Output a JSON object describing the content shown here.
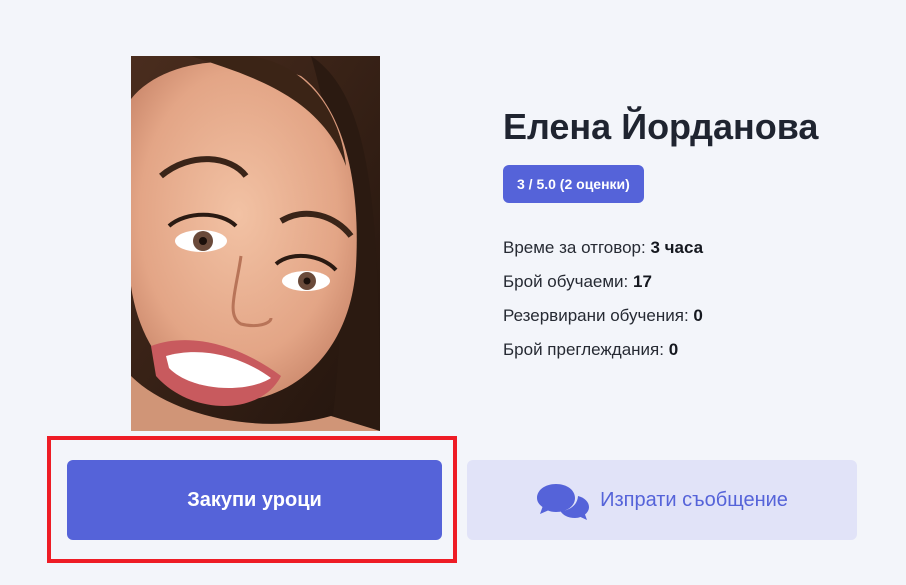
{
  "tutor": {
    "name": "Елена Йорданова",
    "rating": "3 / 5.0 (2 оценки)",
    "photo_alt": "tutor-photo"
  },
  "stats": [
    {
      "label": "Време за отговор: ",
      "value": "3 часа"
    },
    {
      "label": "Брой обучаеми: ",
      "value": "17"
    },
    {
      "label": "Резервирани обучения: ",
      "value": "0"
    },
    {
      "label": "Брой преглеждания: ",
      "value": "0"
    }
  ],
  "actions": {
    "buy_label": "Закупи уроци",
    "message_label": "Изпрати съобщение",
    "message_icon": "chat-bubbles-icon"
  },
  "colors": {
    "accent": "#5563d9",
    "accent_light": "#e1e3f8",
    "highlight": "#ee1c25",
    "background": "#f3f5fa"
  }
}
